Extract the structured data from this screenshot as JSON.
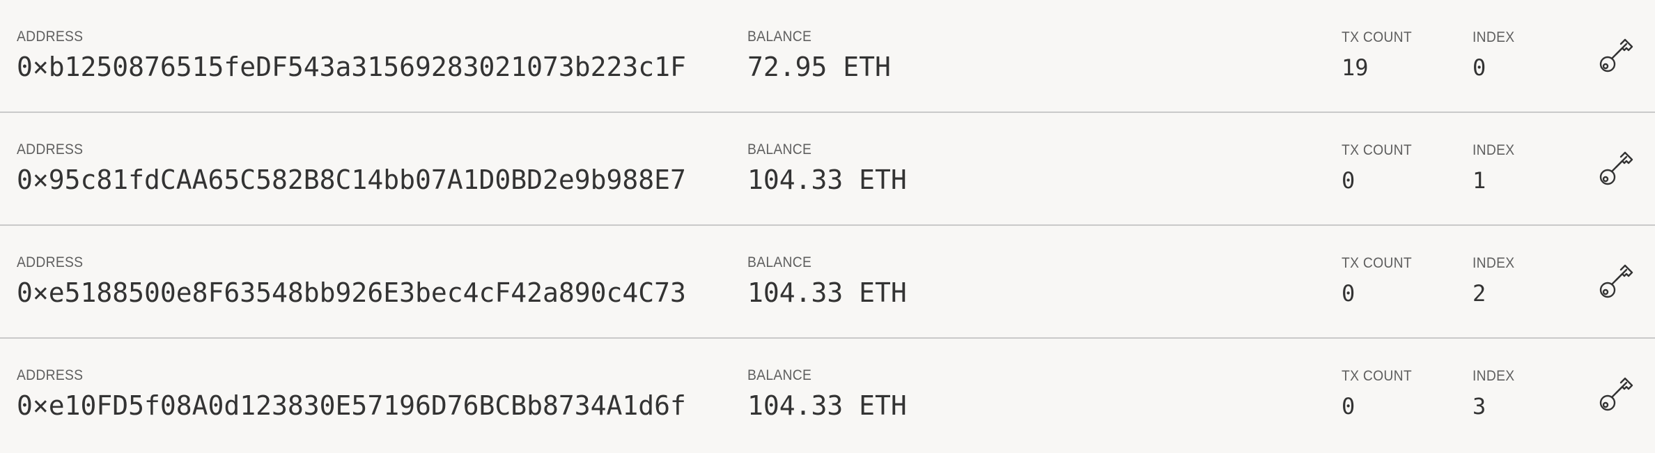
{
  "labels": {
    "address": "ADDRESS",
    "balance": "BALANCE",
    "tx_count": "TX COUNT",
    "index": "INDEX"
  },
  "colors": {
    "background": "#f8f7f5",
    "divider": "#c9c9c9",
    "label_text": "#5f5f5f",
    "value_text": "#333333"
  },
  "key_icon": "key-icon",
  "accounts": [
    {
      "address": "0×b1250876515feDF543a31569283021073b223c1F",
      "balance": "72.95 ETH",
      "tx_count": "19",
      "index": "0"
    },
    {
      "address": "0×95c81fdCAA65C582B8C14bb07A1D0BD2e9b988E7",
      "balance": "104.33 ETH",
      "tx_count": "0",
      "index": "1"
    },
    {
      "address": "0×e5188500e8F63548bb926E3bec4cF42a890c4C73",
      "balance": "104.33 ETH",
      "tx_count": "0",
      "index": "2"
    },
    {
      "address": "0×e10FD5f08A0d123830E57196D76BCBb8734A1d6f",
      "balance": "104.33 ETH",
      "tx_count": "0",
      "index": "3"
    }
  ]
}
